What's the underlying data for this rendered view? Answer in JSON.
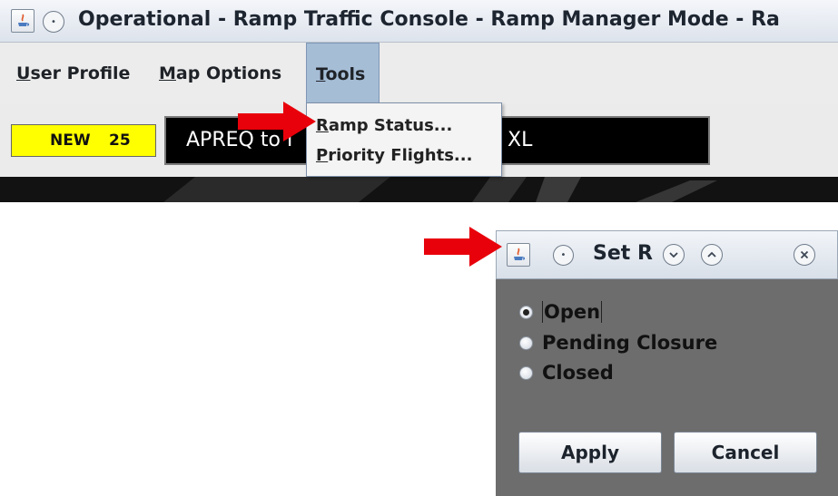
{
  "main_window": {
    "title": "Operational - Ramp Traffic Console - Ramp Manager Mode - Ra"
  },
  "menubar": {
    "items": [
      {
        "label": "User Profile",
        "mnemonic": "U",
        "rest": "ser Profile"
      },
      {
        "label": "Map Options",
        "mnemonic": "M",
        "rest": "ap Options"
      },
      {
        "label": "Tools",
        "mnemonic": "T",
        "rest": "ools"
      }
    ]
  },
  "toolbar": {
    "new_label": "NEW",
    "new_count": "25",
    "message_text": "APREQ to I"
  },
  "tools_menu": {
    "items": [
      {
        "label": "Ramp Status...",
        "mnemonic": "R",
        "rest": "amp Status..."
      },
      {
        "label": "Priority Flights...",
        "mnemonic": "P",
        "rest": "riority Flights..."
      }
    ],
    "behind_suffix": "XL"
  },
  "dialog": {
    "title": "Set R",
    "options": [
      {
        "label": "Open",
        "selected": true
      },
      {
        "label": "Pending Closure",
        "selected": false
      },
      {
        "label": "Closed",
        "selected": false
      }
    ],
    "apply_label": "Apply",
    "cancel_label": "Cancel"
  },
  "colors": {
    "badge_yellow": "#ffff00",
    "menu_highlight": "#a6bdd6",
    "dialog_body": "#6d6d6d",
    "annotation_arrow": "#e8000b"
  },
  "icons": [
    "java-app-icon",
    "circle-menu-icon",
    "minimize-icon",
    "maximize-icon",
    "close-icon",
    "red-arrow-icon"
  ]
}
